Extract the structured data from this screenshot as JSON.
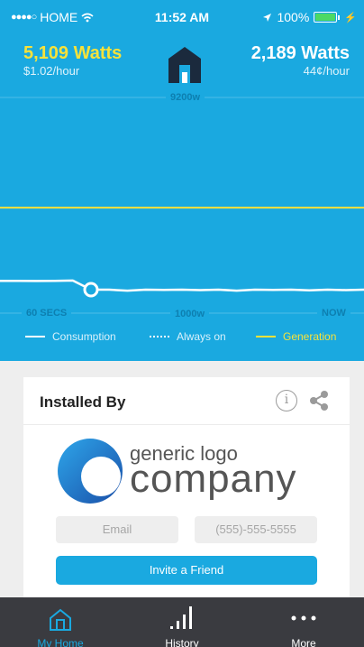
{
  "status_bar": {
    "carrier": "HOME",
    "time": "11:52 AM",
    "battery": "100%"
  },
  "header": {
    "consumption_value": "5,109 Watts",
    "consumption_rate": "$1.02/hour",
    "generation_value": "2,189 Watts",
    "generation_rate": "44¢/hour",
    "logo_icon": "house-logo-icon"
  },
  "chart_data": {
    "type": "line",
    "top_label": "9200w",
    "mid_label": "1000w",
    "x_start_label": "60 SECS",
    "x_end_label": "NOW",
    "series": [
      {
        "name": "Consumption",
        "values": [
          1380,
          1380,
          1370,
          1380,
          1390,
          1000,
          1000,
          960,
          1000,
          990,
          1000,
          980,
          1000,
          960,
          1000,
          990,
          1000,
          970,
          1000,
          980,
          1000
        ]
      },
      {
        "name": "Always on",
        "values": []
      },
      {
        "name": "Generation",
        "values": [
          4500,
          4500,
          4500,
          4500,
          4500,
          4500,
          4500,
          4500,
          4500,
          4500,
          4500,
          4500,
          4500,
          4500,
          4500,
          4500,
          4500,
          4500,
          4500,
          4500,
          4500
        ]
      }
    ],
    "colors": {
      "consumption": "#ffffff",
      "always_on": "#ffffff",
      "generation": "#f7e23a"
    }
  },
  "legend": {
    "consumption": "Consumption",
    "always_on": "Always on",
    "generation": "Generation"
  },
  "card": {
    "title": "Installed By",
    "info_icon": "info-icon",
    "share_icon": "share-icon",
    "logo_text_small": "generic logo",
    "logo_text_big": "company",
    "email_placeholder": "Email",
    "phone_placeholder": "(555)-555-5555",
    "invite_label": "Invite a Friend"
  },
  "tab_bar": {
    "tabs": [
      {
        "label": "My Home",
        "icon": "home-icon"
      },
      {
        "label": "History",
        "icon": "bar-chart-icon"
      },
      {
        "label": "More",
        "icon": "more-icon"
      }
    ]
  },
  "colors": {
    "accent": "#1aa9e0",
    "consumption_yellow": "#f7e23a",
    "tab_bar": "#3a3b40"
  }
}
